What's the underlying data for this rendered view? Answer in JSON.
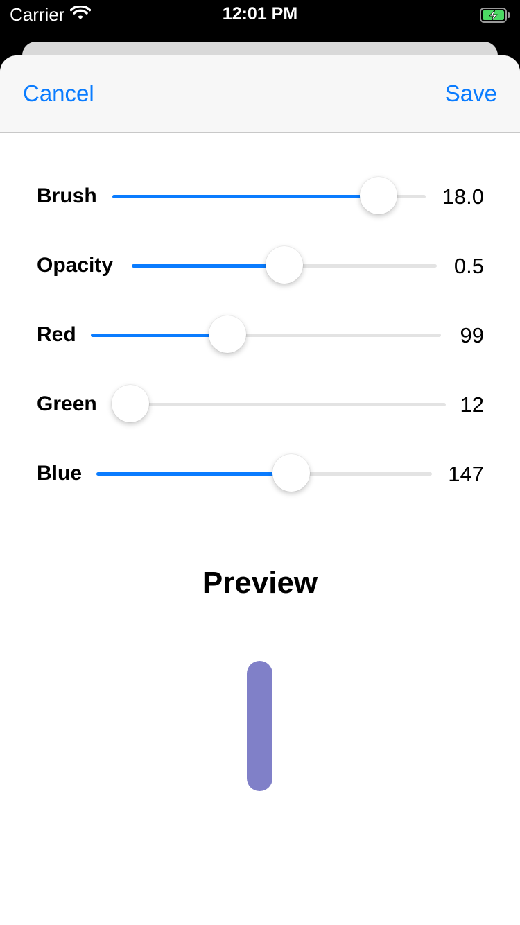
{
  "status_bar": {
    "carrier": "Carrier",
    "time": "12:01 PM",
    "wifi_icon": "wifi-icon",
    "battery_icon": "battery-charging-icon"
  },
  "navbar": {
    "cancel_label": "Cancel",
    "save_label": "Save"
  },
  "settings": [
    {
      "label": "Brush",
      "value": "18.0",
      "fraction": 0.85
    },
    {
      "label": "Opacity",
      "value": "0.5",
      "fraction": 0.5
    },
    {
      "label": "Red",
      "value": "99",
      "fraction": 0.39
    },
    {
      "label": "Green",
      "value": "12",
      "fraction": 0.05
    },
    {
      "label": "Blue",
      "value": "147",
      "fraction": 0.58
    }
  ],
  "preview": {
    "title": "Preview",
    "stroke_color": "#8080c8"
  },
  "colors": {
    "accent": "#0a7cff",
    "track": "#e3e3e3"
  }
}
